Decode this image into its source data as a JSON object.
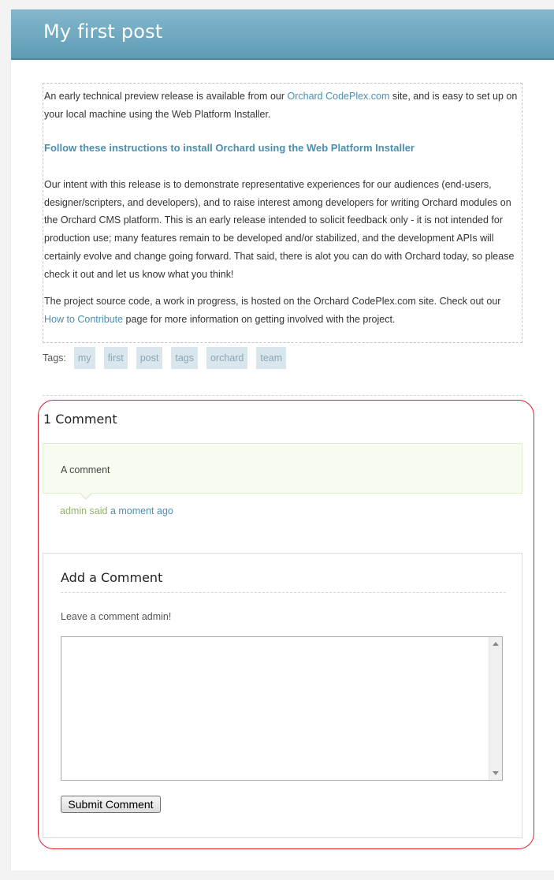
{
  "post": {
    "title": "My first post",
    "para1_before": "An early technical preview release is available from our ",
    "para1_link": "Orchard CodePlex.com",
    "para1_after": " site, and is easy to set up on your local machine using the Web Platform Installer.",
    "instructions_link": "Follow these instructions to install Orchard using the Web Platform Installer",
    "para2": "Our intent with this release is to demonstrate representative experiences for our audiences (end-users, designer/scripters, and developers), and to raise interest among developers for writing Orchard modules on the Orchard CMS platform. This is an early release intended to solicit feedback only - it is not intended for production use; many features remain to be developed and/or stabilized, and the development APIs will certainly evolve and change going forward. That said, there is alot you can do with Orchard today, so please check it out and let us know what you think!",
    "para3_before": "The project source code, a work in progress, is hosted on the Orchard CodePlex.com site. Check out our ",
    "para3_link": "How to Contribute",
    "para3_after": " page for more information on getting involved with the project."
  },
  "tags": {
    "label": "Tags:",
    "items": [
      "my",
      "first",
      "post",
      "tags",
      "orchard",
      "team"
    ]
  },
  "comments": {
    "heading": "1 Comment",
    "items": [
      {
        "text": "A comment",
        "author": "admin",
        "said": " said ",
        "time": "a moment ago"
      }
    ]
  },
  "add_comment": {
    "heading": "Add a Comment",
    "prompt": "Leave a comment admin!",
    "textarea_value": "",
    "submit_label": "Submit Comment"
  },
  "colors": {
    "title_bar": "#6fa9c1",
    "link": "#4a8fb0",
    "author": "#92b36a",
    "highlight": "#e0202a"
  }
}
